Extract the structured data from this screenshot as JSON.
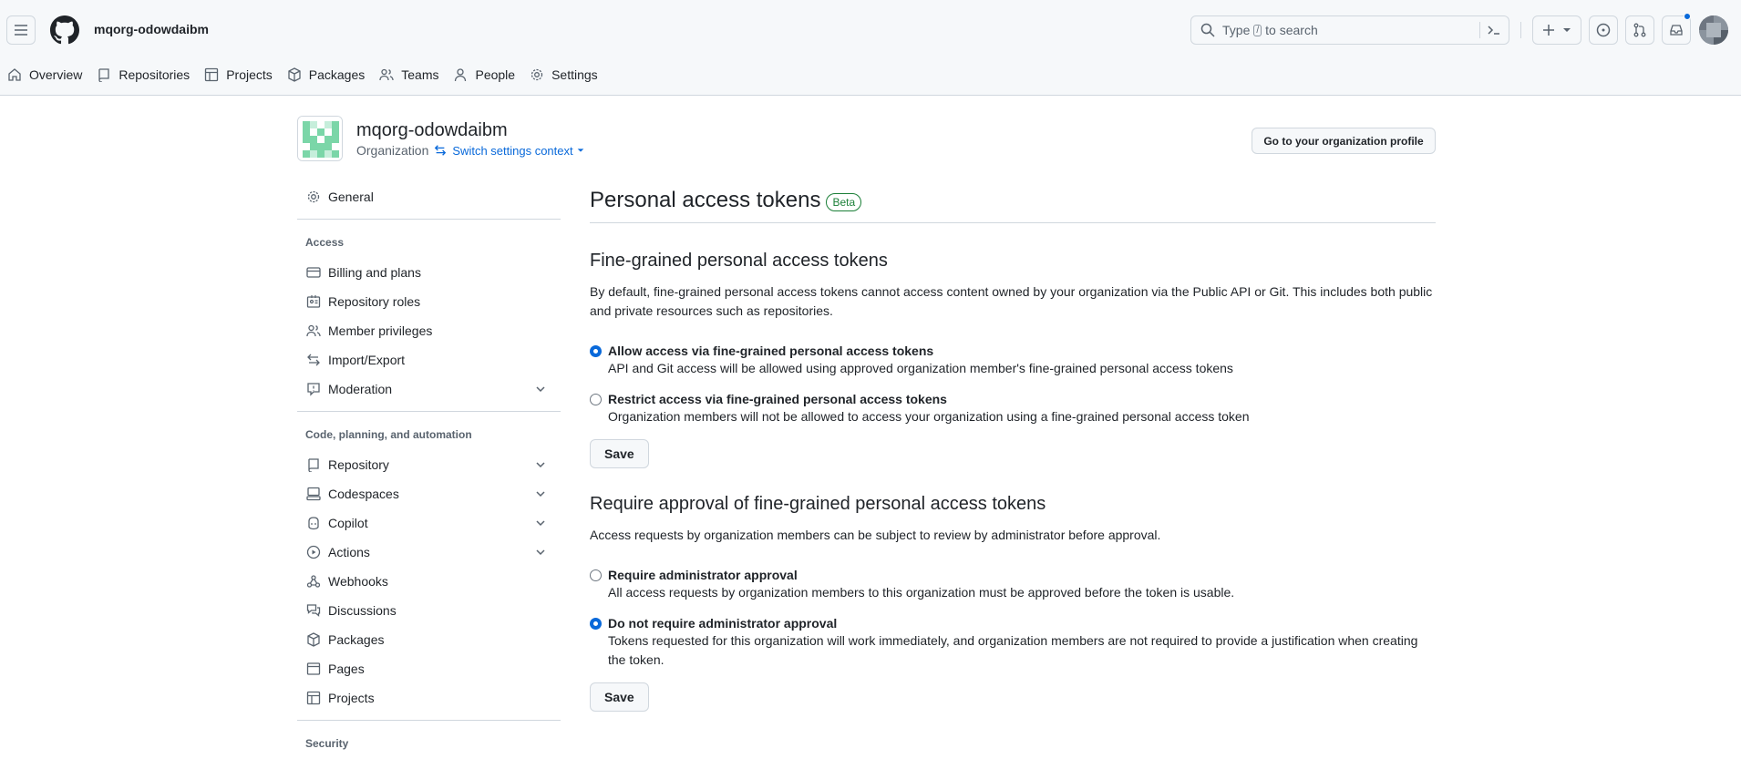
{
  "header": {
    "org_name": "mqorg-odowdaibm",
    "search_prefix": "Type",
    "search_key": "/",
    "search_suffix": "to search"
  },
  "tabs": [
    {
      "label": "Overview",
      "icon": "home-icon"
    },
    {
      "label": "Repositories",
      "icon": "repo-icon"
    },
    {
      "label": "Projects",
      "icon": "table-icon"
    },
    {
      "label": "Packages",
      "icon": "package-icon"
    },
    {
      "label": "Teams",
      "icon": "people-icon"
    },
    {
      "label": "People",
      "icon": "person-icon"
    },
    {
      "label": "Settings",
      "icon": "gear-icon"
    }
  ],
  "org": {
    "title": "mqorg-odowdaibm",
    "type": "Organization",
    "switch_label": "Switch settings context",
    "profile_button": "Go to your organization profile"
  },
  "sidebar": {
    "general": "General",
    "access_heading": "Access",
    "access_items": [
      "Billing and plans",
      "Repository roles",
      "Member privileges",
      "Import/Export",
      "Moderation"
    ],
    "code_heading": "Code, planning, and automation",
    "code_items": [
      "Repository",
      "Codespaces",
      "Copilot",
      "Actions",
      "Webhooks",
      "Discussions",
      "Packages",
      "Pages",
      "Projects"
    ],
    "security_heading": "Security"
  },
  "main": {
    "title": "Personal access tokens",
    "badge": "Beta",
    "fine_grained": {
      "heading": "Fine-grained personal access tokens",
      "description": "By default, fine-grained personal access tokens cannot access content owned by your organization via the Public API or Git. This includes both public and private resources such as repositories.",
      "options": [
        {
          "label": "Allow access via fine-grained personal access tokens",
          "description": "API and Git access will be allowed using approved organization member's fine-grained personal access tokens",
          "selected": true
        },
        {
          "label": "Restrict access via fine-grained personal access tokens",
          "description": "Organization members will not be allowed to access your organization using a fine-grained personal access token",
          "selected": false
        }
      ],
      "save": "Save"
    },
    "approval": {
      "heading": "Require approval of fine-grained personal access tokens",
      "description": "Access requests by organization members can be subject to review by administrator before approval.",
      "options": [
        {
          "label": "Require administrator approval",
          "description": "All access requests by organization members to this organization must be approved before the token is usable.",
          "selected": false
        },
        {
          "label": "Do not require administrator approval",
          "description": "Tokens requested for this organization will work immediately, and organization members are not required to provide a justification when creating the token.",
          "selected": true
        }
      ],
      "save": "Save"
    }
  }
}
